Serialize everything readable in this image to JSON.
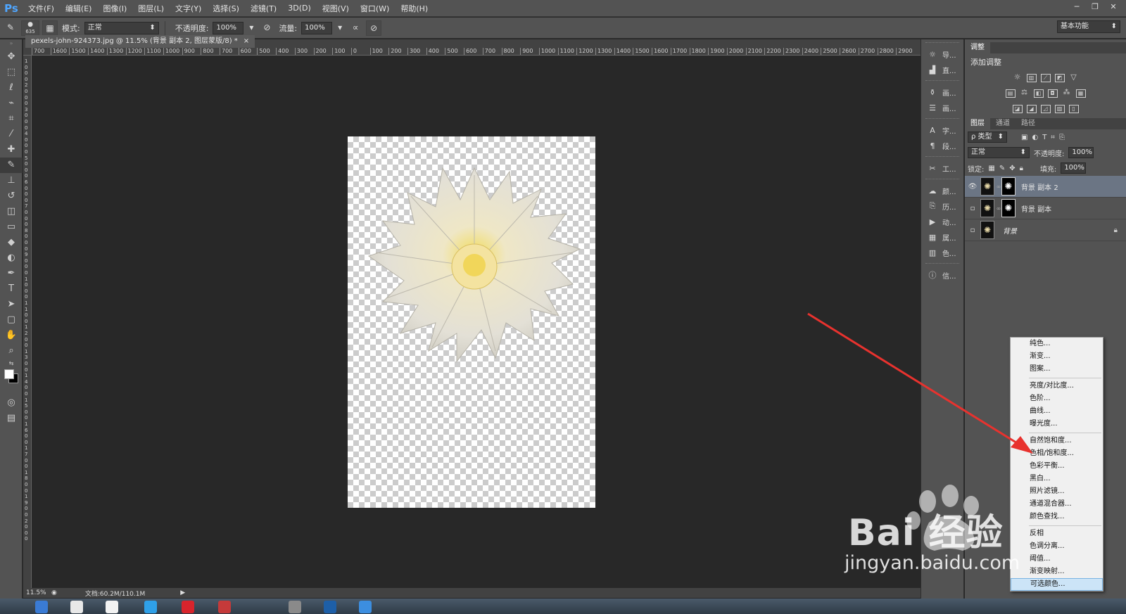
{
  "app": {
    "logo": "Ps",
    "menu": [
      "文件(F)",
      "编辑(E)",
      "图像(I)",
      "图层(L)",
      "文字(Y)",
      "选择(S)",
      "滤镜(T)",
      "3D(D)",
      "视图(V)",
      "窗口(W)",
      "帮助(H)"
    ],
    "window_controls": [
      "─",
      "❐",
      "✕"
    ]
  },
  "options_bar": {
    "brush_size": "635",
    "mode_label": "模式:",
    "mode_value": "正常",
    "opacity_label": "不透明度:",
    "opacity_value": "100%",
    "flow_label": "流量:",
    "flow_value": "100%",
    "workspace": "基本功能"
  },
  "document": {
    "tab_title": "pexels-john-924373.jpg @ 11.5% (背景 副本 2, 图层蒙版/8) *",
    "tab_close": "×",
    "ruler_h": [
      "700",
      "1600",
      "1500",
      "1400",
      "1300",
      "1200",
      "1100",
      "1000",
      "900",
      "800",
      "700",
      "600",
      "500",
      "400",
      "300",
      "200",
      "100",
      "0",
      "100",
      "200",
      "300",
      "400",
      "500",
      "600",
      "700",
      "800",
      "900",
      "1000",
      "1100",
      "1200",
      "1300",
      "1400",
      "1500",
      "1600",
      "1700",
      "1800",
      "1900",
      "2000",
      "2100",
      "2200",
      "2300",
      "2400",
      "2500",
      "2600",
      "2700",
      "2800",
      "2900"
    ]
  },
  "status": {
    "zoom": "11.5%",
    "doc_size": "文档:60.2M/110.1M"
  },
  "dock": {
    "items": [
      {
        "icon": "☼",
        "label": "导..."
      },
      {
        "icon": "▟",
        "label": "直..."
      },
      {
        "icon": "⚱",
        "label": "画..."
      },
      {
        "icon": "☰",
        "label": "画..."
      },
      {
        "icon": "A",
        "label": "字..."
      },
      {
        "icon": "¶",
        "label": "段..."
      },
      {
        "icon": "✂",
        "label": "工..."
      },
      {
        "icon": "☁",
        "label": "颜..."
      },
      {
        "icon": "⎘",
        "label": "历..."
      },
      {
        "icon": "▶",
        "label": "动..."
      },
      {
        "icon": "▦",
        "label": "属..."
      },
      {
        "icon": "▥",
        "label": "色..."
      },
      {
        "icon": "ⓘ",
        "label": "信..."
      }
    ]
  },
  "adjustments": {
    "tab": "调整",
    "title": "添加调整"
  },
  "layers_panel": {
    "tabs": [
      "图层",
      "通道",
      "路径"
    ],
    "filter_label": "ρ 类型",
    "blend_mode": "正常",
    "opacity_label": "不透明度:",
    "opacity_value": "100%",
    "lock_label": "锁定:",
    "fill_label": "填充:",
    "fill_value": "100%",
    "layers": [
      {
        "name": "背景 副本 2",
        "selected": true,
        "has_mask": true,
        "visible": true
      },
      {
        "name": "背景 副本",
        "selected": false,
        "has_mask": true,
        "visible": false
      },
      {
        "name": "背景",
        "selected": false,
        "has_mask": false,
        "visible": false,
        "locked": true
      }
    ]
  },
  "context_menu": {
    "groups": [
      [
        "纯色...",
        "渐变...",
        "图案..."
      ],
      [
        "亮度/对比度...",
        "色阶...",
        "曲线...",
        "曝光度..."
      ],
      [
        "自然饱和度...",
        "色相/饱和度...",
        "色彩平衡...",
        "黑白...",
        "照片滤镜...",
        "通道混合器...",
        "颜色查找..."
      ],
      [
        "反相",
        "色调分离...",
        "阈值...",
        "渐变映射...",
        "可选颜色..."
      ]
    ],
    "highlighted": "可选颜色..."
  },
  "watermark": {
    "brand": "Bai 经验",
    "url": "jingyan.baidu.com"
  },
  "colors": {
    "accent_arrow": "#e8322e",
    "selected_layer": "#6b7584",
    "menu_highlight": "#cce4f7"
  }
}
